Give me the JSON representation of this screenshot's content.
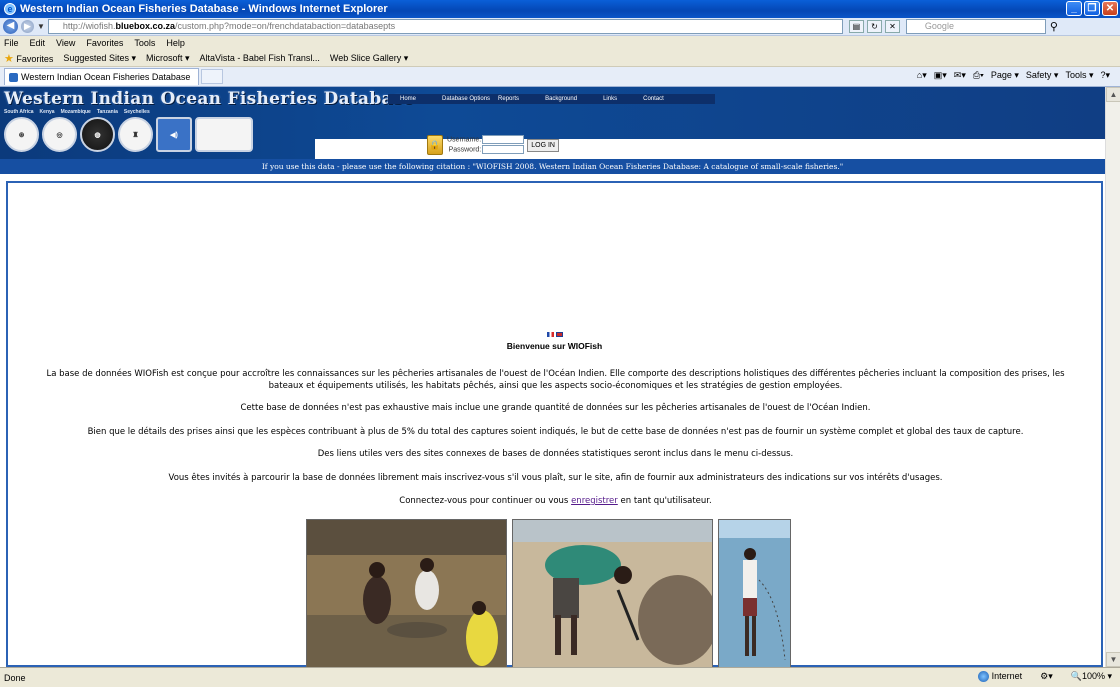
{
  "window": {
    "title": "Western Indian Ocean Fisheries Database - Windows Internet Explorer"
  },
  "address_bar": {
    "url_prefix": "http://",
    "url_host_dim": "wiofish.",
    "url_host": "bluebox.co.za",
    "url_rest": "/custom.php?mode=on/frenchdatabaction=databasepts",
    "search_placeholder": "Google"
  },
  "menu": {
    "items": [
      "File",
      "Edit",
      "View",
      "Favorites",
      "Tools",
      "Help"
    ]
  },
  "favorites_bar": {
    "favorites_label": "Favorites",
    "items": [
      "Suggested Sites ▾",
      "Microsoft ▾",
      "AltaVista - Babel Fish Transl...",
      "Web Slice Gallery ▾"
    ]
  },
  "tab": {
    "label": "Western Indian Ocean Fisheries Database"
  },
  "command_bar": {
    "page": "Page ▾",
    "safety": "Safety ▾",
    "tools": "Tools ▾"
  },
  "site": {
    "title": "Western Indian Ocean Fisheries Database",
    "countries": [
      "South Africa",
      "Kenya",
      "Mozambique",
      "Tanzania",
      "Seychelles"
    ],
    "nav": [
      "Home",
      "Database Options",
      "Reports",
      "Background",
      "Links",
      "Contact"
    ],
    "login": {
      "username_label": "Username",
      "password_label": "Password",
      "button": "LOG IN"
    },
    "citation": "If you use this data - please use the following citation : \"WIOFISH 2008. Western Indian Ocean Fisheries Database: A catalogue of small-scale fisheries.\""
  },
  "content": {
    "welcome": "Bienvenue sur WIOFish",
    "p1": "La base de données WIOFish est conçue pour accroître les connaissances sur les pêcheries artisanales de l'ouest de l'Océan Indien. Elle comporte des descriptions holistiques des différentes pêcheries incluant la composition des prises, les bateaux et équipements utilisés, les habitats pêchés, ainsi que les aspects socio-économiques et les stratégies de gestion employées.",
    "p2": "Cette base de données n'est pas exhaustive mais inclue une grande quantité de données sur les pêcheries artisanales de l'ouest de l'Océan Indien.",
    "p3": "Bien que le détails des prises ainsi que les espèces contribuant à plus de 5% du total des captures soient indiqués, le but de cette base de données n'est pas de fournir un système complet et global des taux de capture.",
    "p4": "Des liens utiles vers des sites connexes de bases de données statistiques seront inclus dans le menu ci-dessus.",
    "p5": "Vous êtes invités à parcourir la base de données librement mais inscrivez-vous s'il vous plaît, sur le site, afin de fournir aux administrateurs des indications sur vos intérêts d'usages.",
    "p6_before": "Connectez-vous pour continuer ou vous ",
    "p6_link": "enregistrer",
    "p6_after": " en tant qu'utilisateur."
  },
  "status_bar": {
    "left": "Done",
    "zone": "Internet",
    "zoom": "100%"
  }
}
